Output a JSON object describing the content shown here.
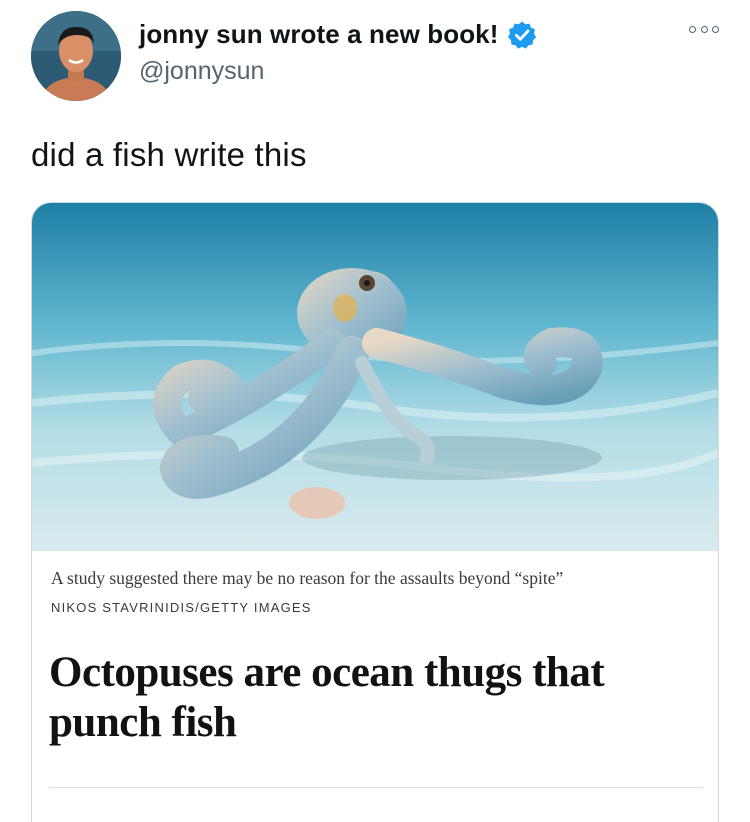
{
  "author": {
    "display_name": "jonny sun wrote a new book!",
    "handle": "@jonnysun",
    "verified": true,
    "avatar_icon": "avatar-photo"
  },
  "tweet": {
    "text": "did a fish write this"
  },
  "card": {
    "image_icon": "octopus-photo",
    "caption": "A study suggested there may be no reason for the assaults beyond “spite”",
    "credit": "NIKOS STAVRINIDIS/GETTY IMAGES",
    "headline": "Octopuses are ocean thugs that punch fish"
  },
  "colors": {
    "verified_blue": "#1d9bf0",
    "text_primary": "#0f1419",
    "text_secondary": "#536471",
    "card_border": "#cfd9de"
  }
}
